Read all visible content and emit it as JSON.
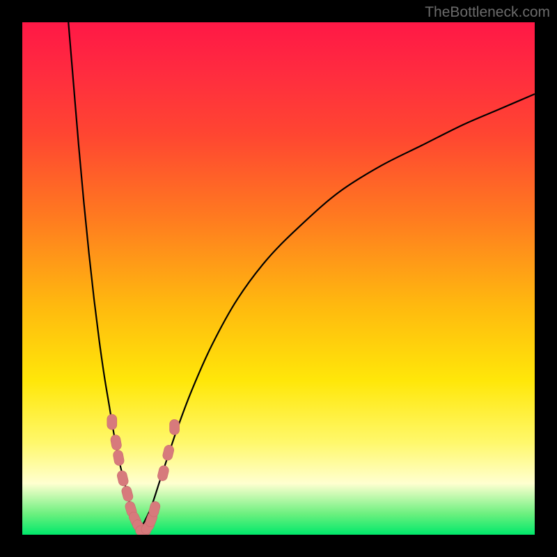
{
  "watermark": "TheBottleneck.com",
  "colors": {
    "frame": "#000000",
    "curve": "#000000",
    "marker_fill": "#d77a7c",
    "marker_stroke": "#c86a6d",
    "gradient_stops": [
      "#ff1846",
      "#ff2c3f",
      "#ff4631",
      "#ff7a20",
      "#ffb80f",
      "#ffe709",
      "#fff86b",
      "#ffffd0",
      "#6af07e",
      "#00e86b"
    ]
  },
  "chart_data": {
    "type": "line",
    "title": "",
    "xlabel": "",
    "ylabel": "",
    "xlim": [
      0,
      100
    ],
    "ylim": [
      0,
      100
    ],
    "series": [
      {
        "name": "left-branch",
        "x": [
          9,
          10,
          11,
          12,
          13,
          14,
          15,
          16,
          17,
          18,
          19,
          20,
          21,
          22,
          23
        ],
        "values": [
          100,
          88,
          76,
          65,
          55,
          46,
          38,
          31,
          25,
          19,
          14,
          10,
          6,
          3,
          1
        ]
      },
      {
        "name": "right-branch",
        "x": [
          23,
          25,
          27,
          30,
          33,
          37,
          42,
          48,
          55,
          62,
          70,
          78,
          86,
          93,
          100
        ],
        "values": [
          1,
          5,
          11,
          20,
          28,
          37,
          46,
          54,
          61,
          67,
          72,
          76,
          80,
          83,
          86
        ]
      }
    ],
    "markers": {
      "name": "highlighted-points",
      "x": [
        17.5,
        18.3,
        18.8,
        19.6,
        20.5,
        21.2,
        22.0,
        22.8,
        23.6,
        24.5,
        25.2,
        25.8,
        27.5,
        28.5,
        29.7
      ],
      "values": [
        22,
        18,
        15,
        11,
        8,
        5,
        3,
        1.5,
        0.8,
        1.5,
        3,
        5,
        12,
        16,
        21
      ]
    }
  }
}
